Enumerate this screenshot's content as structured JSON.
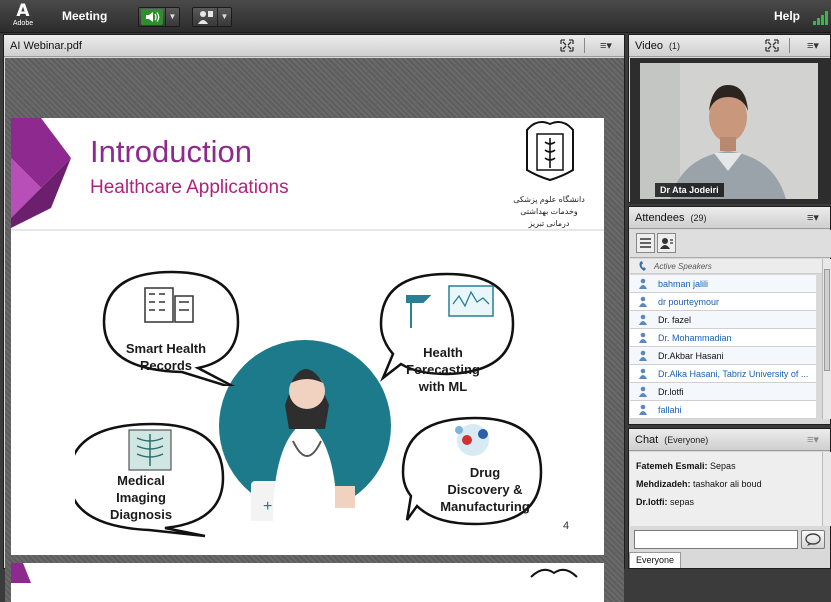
{
  "topbar": {
    "logo_text": "Adobe",
    "meeting_label": "Meeting",
    "help_label": "Help"
  },
  "share_pod": {
    "title": "AI Webinar.pdf",
    "menu_icon": "≡▾"
  },
  "slide": {
    "title": "Introduction",
    "subtitle": "Healthcare Applications",
    "university_caption_line1": "دانشگاه علوم پزشکی",
    "university_caption_line2": "وخدمات بهداشتی درمانی تبریز",
    "bubbles": {
      "smart_health": "Smart Health\nRecords",
      "forecasting": "Health\nForecasting\nwith ML",
      "imaging": "Medical\nImaging\nDiagnosis",
      "drug": "Drug\nDiscovery &\nManufacturing"
    },
    "page_number": "4"
  },
  "video_pod": {
    "title": "Video",
    "count": "(1)",
    "menu_icon": "≡▾",
    "speaker_name": "Dr Ata Jodeiri"
  },
  "attendees_pod": {
    "title": "Attendees",
    "count": "(29)",
    "menu_icon": "≡▾",
    "active_speakers_label": "Active Speakers",
    "rows": [
      {
        "name": "bahman jalili",
        "color": "#1a5fb4"
      },
      {
        "name": "dr pourteymour",
        "color": "#1a5fb4"
      },
      {
        "name": "Dr. fazel",
        "color": "#111111"
      },
      {
        "name": "Dr. Mohammadian",
        "color": "#1a5fb4"
      },
      {
        "name": "Dr.Akbar Hasani",
        "color": "#111111"
      },
      {
        "name": "Dr.Alka Hasani, Tabriz University of ...",
        "color": "#1a5fb4"
      },
      {
        "name": "Dr.lotfi",
        "color": "#111111"
      },
      {
        "name": "fallahi",
        "color": "#1a5fb4"
      }
    ]
  },
  "chat_pod": {
    "title": "Chat",
    "audience": "(Everyone)",
    "menu_icon": "≡▾",
    "messages": [
      {
        "sender": "Fatemeh Esmali:",
        "text": "Sepas"
      },
      {
        "sender": "Mehdizadeh:",
        "text": "tashakor ali boud"
      },
      {
        "sender": "Dr.lotfi:",
        "text": "sepas"
      }
    ],
    "tab_label": "Everyone"
  }
}
